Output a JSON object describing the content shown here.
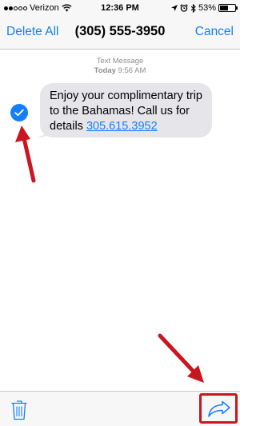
{
  "status_bar": {
    "carrier": "Verizon",
    "time": "12:36 PM",
    "battery": "53%",
    "battery_level": 0.53,
    "signal_bars_filled": 2,
    "icons": [
      "signal-dots-icon",
      "wifi-icon",
      "location-icon",
      "alarm-icon",
      "bluetooth-icon",
      "battery-icon"
    ]
  },
  "nav": {
    "left_label": "Delete All",
    "title": "(305) 555-3950",
    "right_label": "Cancel"
  },
  "message_meta": {
    "type_label": "Text Message",
    "day": "Today",
    "time": "9:56 AM"
  },
  "message": {
    "text": "Enjoy your complimentary trip to the Bahamas! Call us for details ",
    "link": "305.615.3952",
    "selected": true
  },
  "toolbar": {
    "icons": [
      "trash-icon",
      "forward-icon"
    ]
  },
  "colors": {
    "accent": "#147efb",
    "bubble": "#e5e5ea",
    "annotation": "#c8171e",
    "bar_bg": "#f7f7f7"
  }
}
